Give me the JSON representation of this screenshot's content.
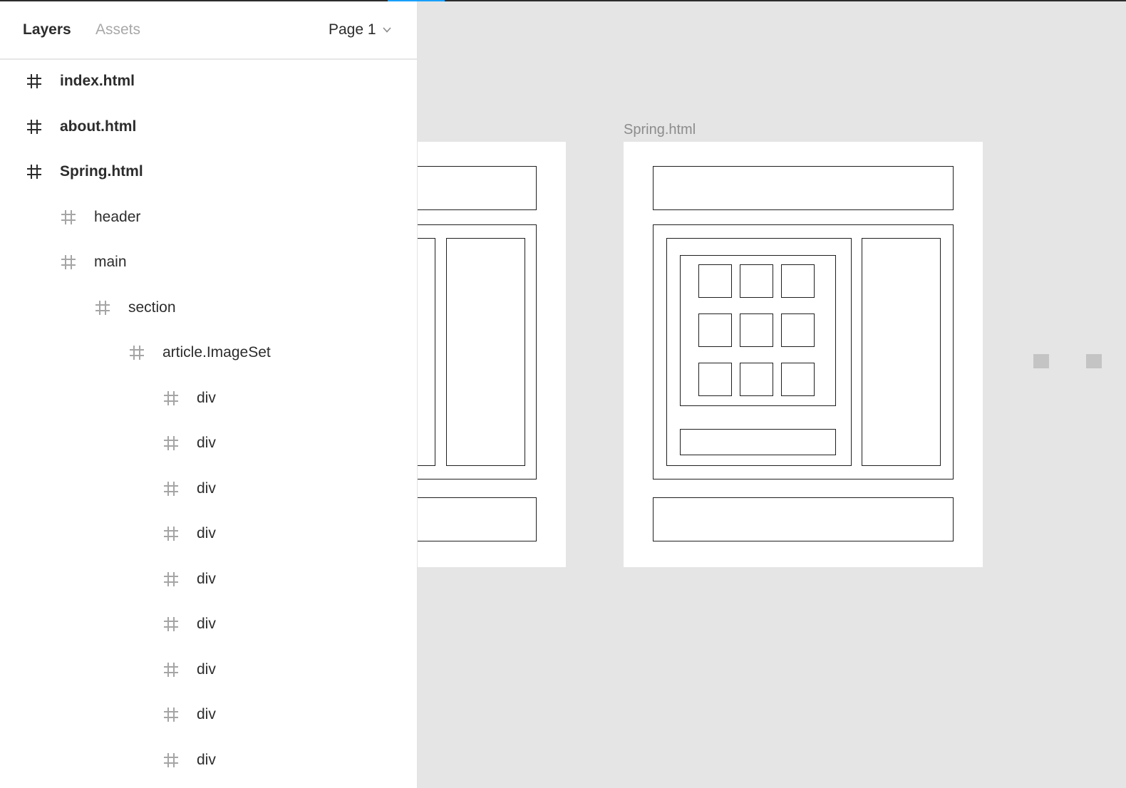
{
  "panel": {
    "tabs": {
      "layers": "Layers",
      "assets": "Assets"
    },
    "page_selector": {
      "label": "Page 1",
      "icon": "chevron-down-icon"
    }
  },
  "layers": [
    {
      "label": "index.html",
      "kind": "frame",
      "depth": 0
    },
    {
      "label": "about.html",
      "kind": "frame",
      "depth": 0
    },
    {
      "label": "Spring.html",
      "kind": "frame",
      "depth": 0
    },
    {
      "label": "header",
      "kind": "child",
      "depth": 1
    },
    {
      "label": "main",
      "kind": "child",
      "depth": 1
    },
    {
      "label": "section",
      "kind": "child",
      "depth": 2
    },
    {
      "label": "article.ImageSet",
      "kind": "child",
      "depth": 3
    },
    {
      "label": "div",
      "kind": "child",
      "depth": 4
    },
    {
      "label": "div",
      "kind": "child",
      "depth": 4
    },
    {
      "label": "div",
      "kind": "child",
      "depth": 4
    },
    {
      "label": "div",
      "kind": "child",
      "depth": 4
    },
    {
      "label": "div",
      "kind": "child",
      "depth": 4
    },
    {
      "label": "div",
      "kind": "child",
      "depth": 4
    },
    {
      "label": "div",
      "kind": "child",
      "depth": 4
    },
    {
      "label": "div",
      "kind": "child",
      "depth": 4
    },
    {
      "label": "div",
      "kind": "child",
      "depth": 4
    }
  ],
  "canvas": {
    "frame_title": "Spring.html",
    "colors": {
      "background": "#e5e5e5",
      "frame": "#ffffff",
      "wireframe_stroke": "#1f1f1f",
      "selection_accent": "#18a0fb"
    }
  }
}
